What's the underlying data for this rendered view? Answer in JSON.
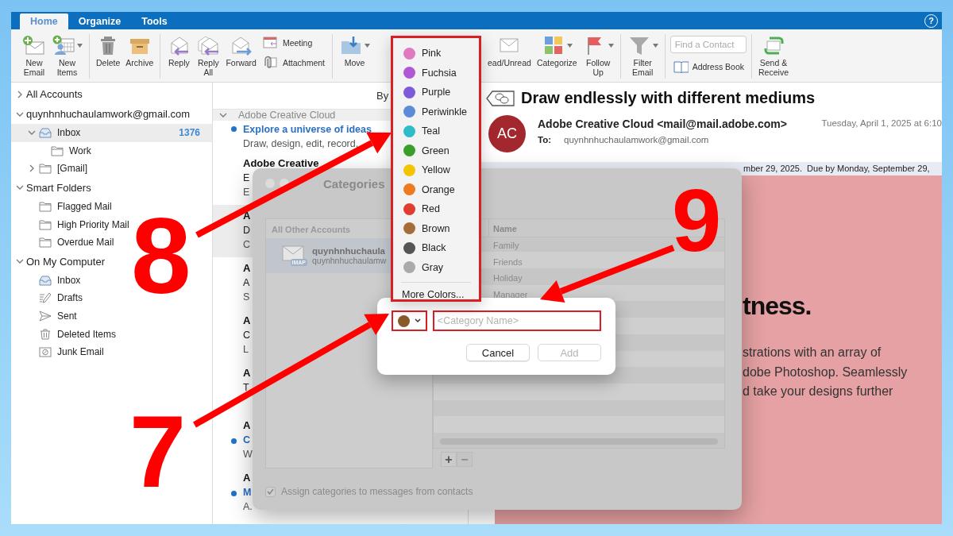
{
  "tab_bar": {
    "tabs": [
      {
        "label": "Home",
        "selected": true
      },
      {
        "label": "Organize",
        "selected": false
      },
      {
        "label": "Tools",
        "selected": false
      }
    ],
    "help": "?"
  },
  "toolbar": {
    "groups": [
      {
        "buttons": [
          {
            "kind": "large",
            "label": "New\nEmail",
            "menu": false
          },
          {
            "kind": "large",
            "label": "New\nItems",
            "menu": true
          }
        ]
      },
      {
        "buttons": [
          {
            "kind": "large",
            "label": "Delete",
            "menu": false
          },
          {
            "kind": "large",
            "label": "Archive",
            "menu": false
          }
        ]
      },
      {
        "buttons": [
          {
            "kind": "large",
            "label": "Reply",
            "menu": false
          },
          {
            "kind": "large",
            "label": "Reply\nAll",
            "menu": false
          },
          {
            "kind": "large",
            "label": "Forward",
            "menu": false
          },
          {
            "kind": "small",
            "label": "Meeting"
          },
          {
            "kind": "small",
            "label": "Attachment"
          }
        ]
      },
      {
        "buttons": [
          {
            "kind": "large",
            "label": "Move",
            "menu": true
          }
        ]
      },
      {
        "buttons": [
          {
            "kind": "large",
            "label": "ead/Unread",
            "menu": false
          },
          {
            "kind": "large",
            "label": "Categorize",
            "menu": true
          },
          {
            "kind": "large",
            "label": "Follow\nUp",
            "menu": true
          }
        ]
      },
      {
        "buttons": [
          {
            "kind": "large",
            "label": "Filter\nEmail",
            "menu": true
          }
        ]
      },
      {
        "buttons": [
          {
            "kind": "field",
            "placeholder": "Find a Contact"
          },
          {
            "kind": "small",
            "label": "Address Book"
          }
        ]
      },
      {
        "buttons": [
          {
            "kind": "large",
            "label": "Send &\nReceive",
            "menu": false
          }
        ]
      }
    ]
  },
  "sidebar": {
    "items": [
      {
        "label": "All Accounts",
        "kind": "header",
        "expanded": false,
        "selected": false
      },
      {
        "label": "quynhnhuchaulamwork@gmail.com",
        "kind": "header",
        "expanded": true,
        "selected": false,
        "children": [
          {
            "label": "Inbox",
            "kind": "inbox",
            "expanded": true,
            "selected": true,
            "count": "1376",
            "children": [
              {
                "label": "Work",
                "kind": "folder",
                "selected": false
              }
            ]
          },
          {
            "label": "[Gmail]",
            "kind": "folder",
            "expanded": false,
            "selected": false
          }
        ]
      },
      {
        "label": "Smart Folders",
        "kind": "header",
        "expanded": true,
        "selected": false,
        "children": [
          {
            "label": "Flagged Mail",
            "kind": "folder",
            "selected": false
          },
          {
            "label": "High Priority Mail",
            "kind": "folder",
            "selected": false
          },
          {
            "label": "Overdue Mail",
            "kind": "folder",
            "selected": false
          }
        ]
      },
      {
        "label": "On My Computer",
        "kind": "header",
        "expanded": true,
        "selected": false,
        "children": [
          {
            "label": "Inbox",
            "kind": "inbox",
            "selected": false
          },
          {
            "label": "Drafts",
            "kind": "drafts",
            "selected": false
          },
          {
            "label": "Sent",
            "kind": "sent",
            "selected": false
          },
          {
            "label": "Deleted Items",
            "kind": "trash",
            "selected": false
          },
          {
            "label": "Junk Email",
            "kind": "junk",
            "selected": false
          }
        ]
      }
    ]
  },
  "message_list": {
    "sort_label": "By",
    "groups": [
      {
        "label": "Adobe Creative Cloud",
        "expanded": true,
        "messages": [
          {
            "subject": "Explore a universe of ideas",
            "preview": "Draw, design, edit, record,",
            "unread": true,
            "selected": false
          },
          {
            "sender": "Adobe Creative",
            "subject": "E",
            "preview": "E",
            "unread": false,
            "selected": false
          },
          {
            "sender": "A",
            "subject": "D",
            "preview": "C",
            "unread": false,
            "selected": true
          },
          {
            "sender": "A",
            "subject": "A",
            "preview": "S",
            "unread": false,
            "selected": false
          },
          {
            "sender": "A",
            "subject": "C",
            "preview": "L",
            "unread": false,
            "selected": false
          },
          {
            "sender": "A",
            "subject": "T",
            "unread": false,
            "selected": false
          },
          {
            "sender": "A",
            "subject": "C",
            "preview": "W",
            "unread": true,
            "selected": false
          },
          {
            "sender": "A",
            "subject": "M",
            "preview": "A.",
            "unread": true,
            "selected": false
          }
        ]
      }
    ]
  },
  "reading_pane": {
    "subject": "Draw endlessly with different mediums",
    "avatar": "AC",
    "sender": "Adobe Creative Cloud <mail@mail.adobe.com>",
    "date": "Tuesday, April 1, 2025 at 6:10",
    "to_label": "To:",
    "to": "quynhnhuchaulamwork@gmail.com",
    "banner": "mber 29, 2025.  Due by Monday, September 29,",
    "heading": "tness.",
    "body_lines": [
      "strations with an array of",
      "dobe Photoshop. Seamlessly",
      "d take your designs further"
    ]
  },
  "categories_dialog": {
    "title": "Categories",
    "accounts_header": "All Other Accounts",
    "accounts": [
      {
        "name": "quynhnhuchaula",
        "address": "quynhnhuchaulamw",
        "badge": "IMAP",
        "selected": true
      }
    ],
    "column": "Name",
    "categories": [
      "Family",
      "Friends",
      "Holiday",
      "Manager"
    ],
    "buttons": [
      {
        "label": "+",
        "disabled": false
      },
      {
        "label": "−",
        "disabled": true
      }
    ],
    "assign": {
      "label": "Assign categories to messages from contacts",
      "checked": true
    }
  },
  "new_category_sheet": {
    "color": "#8b5a2b",
    "highlighted": true,
    "placeholder": "<Category Name>",
    "field_highlighted": true,
    "buttons": [
      {
        "label": "Cancel",
        "disabled": false
      },
      {
        "label": "Add",
        "disabled": true
      }
    ]
  },
  "color_menu": {
    "highlighted": true,
    "items": [
      {
        "label": "Pink",
        "color": "#e07ac0"
      },
      {
        "label": "Fuchsia",
        "color": "#b157d6"
      },
      {
        "label": "Purple",
        "color": "#7d5ad8"
      },
      {
        "label": "Periwinkle",
        "color": "#5b8bd9"
      },
      {
        "label": "Teal",
        "color": "#2fbcca"
      },
      {
        "label": "Green",
        "color": "#3a9f2a"
      },
      {
        "label": "Yellow",
        "color": "#f5c400"
      },
      {
        "label": "Orange",
        "color": "#ec7b22"
      },
      {
        "label": "Red",
        "color": "#e03c31"
      },
      {
        "label": "Brown",
        "color": "#a66d3a"
      },
      {
        "label": "Black",
        "color": "#555555"
      },
      {
        "label": "Gray",
        "color": "#aaaaaa"
      }
    ],
    "more": "More Colors..."
  },
  "annotations": [
    {
      "label": "8"
    },
    {
      "label": "9"
    },
    {
      "label": "7"
    }
  ]
}
